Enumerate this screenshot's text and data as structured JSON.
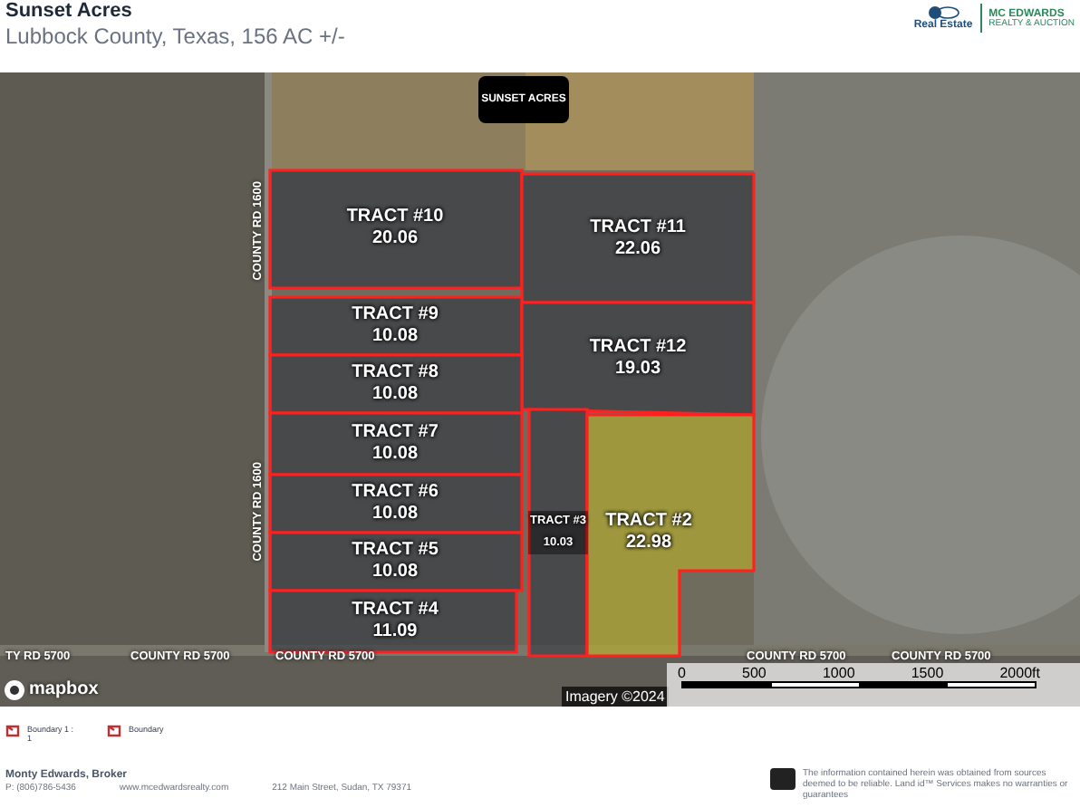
{
  "header": {
    "title": "Sunset Acres",
    "subtitle": "Lubbock County, Texas, 156 AC +/-"
  },
  "logos": {
    "brokerage": "Real Estate",
    "company": "MC EDWARDS",
    "company_tagline": "REALTY & AUCTION"
  },
  "map": {
    "badge": "SUNSET ACRES",
    "tracts": [
      {
        "name": "TRACT #10",
        "acres": "20.06",
        "highlighted": false
      },
      {
        "name": "TRACT #11",
        "acres": "22.06",
        "highlighted": false
      },
      {
        "name": "TRACT #9",
        "acres": "10.08",
        "highlighted": false
      },
      {
        "name": "TRACT #12",
        "acres": "19.03",
        "highlighted": false
      },
      {
        "name": "TRACT #8",
        "acres": "10.08",
        "highlighted": false
      },
      {
        "name": "TRACT #7",
        "acres": "10.08",
        "highlighted": false
      },
      {
        "name": "TRACT #6",
        "acres": "10.08",
        "highlighted": false
      },
      {
        "name": "TRACT #3",
        "acres": "10.03",
        "highlighted": false
      },
      {
        "name": "TRACT #2",
        "acres": "22.98",
        "highlighted": true
      },
      {
        "name": "TRACT #5",
        "acres": "10.08",
        "highlighted": false
      },
      {
        "name": "TRACT #4",
        "acres": "11.09",
        "highlighted": false
      }
    ],
    "road_labels": [
      {
        "text": "COUNTY RD 1600",
        "vertical": true
      },
      {
        "text": "COUNTY RD 1600",
        "vertical": true
      },
      {
        "text": "TY RD 5700",
        "vertical": false
      },
      {
        "text": "COUNTY RD 5700",
        "vertical": false
      },
      {
        "text": "COUNTY RD 5700",
        "vertical": false
      },
      {
        "text": "COUNTY RD 5700",
        "vertical": false
      },
      {
        "text": "COUNTY RD 5700",
        "vertical": false
      }
    ],
    "attribution": "mapbox",
    "imagery": "Imagery ©2024",
    "scale_ticks": [
      "0",
      "500",
      "1000",
      "1500",
      "2000ft"
    ]
  },
  "legend": [
    {
      "label": "Boundary 1 : 1"
    },
    {
      "label": "Boundary"
    }
  ],
  "footer": {
    "broker": "Monty Edwards, Broker",
    "phone": "P: (806)786-5436",
    "website": "www.mcedwardsrealty.com",
    "address": "212 Main Street, Sudan, TX 79371",
    "disclaimer": "The information contained herein was obtained from sources deemed to be reliable. Land id™ Services makes no warranties or guarantees"
  }
}
